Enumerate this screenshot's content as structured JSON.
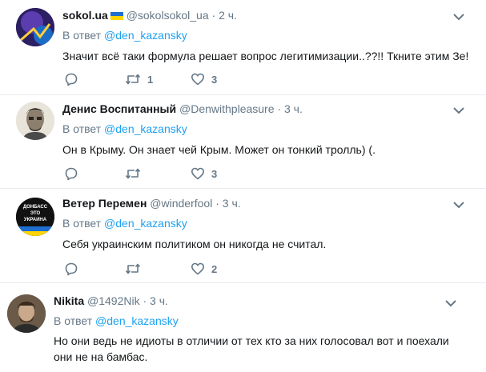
{
  "reply_prefix": "В ответ",
  "tweets": [
    {
      "name": "sokol.ua",
      "handle": "@sokolsokol_ua",
      "separator": " · ",
      "time": "2 ч.",
      "reply_to": "@den_kazansky",
      "text": "Значит всё таки формула  решает вопрос легитимизации..??!! Ткните этим Зе!",
      "retweets": "1",
      "likes": "3"
    },
    {
      "name": "Денис Воспитанный",
      "handle": "@Denwithpleasure",
      "separator": " · ",
      "time": "3 ч.",
      "reply_to": "@den_kazansky",
      "text": "Он в Крыму. Он знает чей Крым. Может он тонкий тролль) (.",
      "retweets": "",
      "likes": "3"
    },
    {
      "name": "Ветер Перемен",
      "handle": "@winderfool",
      "separator": " · ",
      "time": "3 ч.",
      "reply_to": "@den_kazansky",
      "text": "Себя украинским политиком он никогда не считал.",
      "retweets": "",
      "likes": "2",
      "avatar_text": "ДОНБАСС ЭТО УКРАИНА"
    },
    {
      "name": "Nikita",
      "handle": "@1492Nik",
      "separator": " · ",
      "time": "3 ч.",
      "reply_to": "@den_kazansky",
      "text": "Но они ведь не идиоты в отличии от тех кто за них голосовал вот и поехали они не на бамбас."
    }
  ],
  "icons": {
    "reply": "reply-icon",
    "retweet": "retweet-icon",
    "like": "heart-icon",
    "more": "chevron-down-icon"
  },
  "colors": {
    "link": "#1da1f2",
    "muted": "#657786",
    "text": "#14171a",
    "divider": "#e6ecf0"
  }
}
